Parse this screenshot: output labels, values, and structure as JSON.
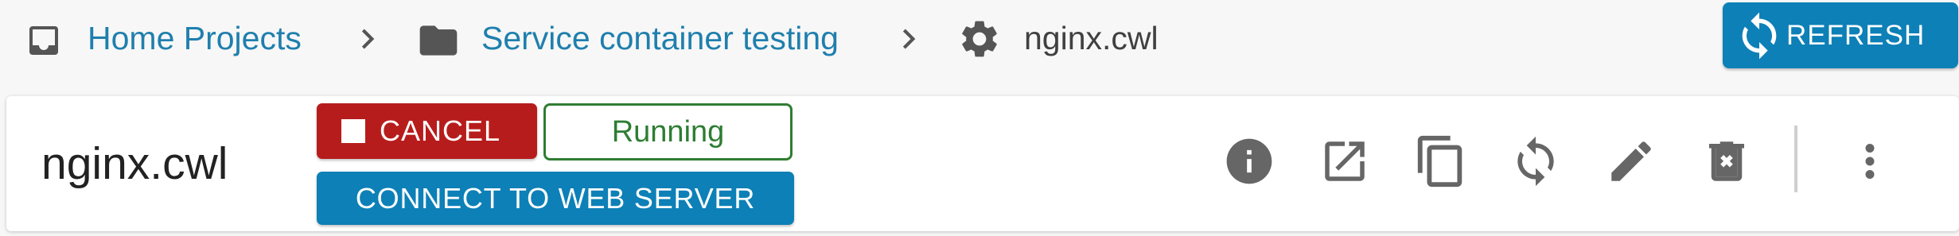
{
  "breadcrumb": {
    "items": [
      {
        "label": "Home Projects",
        "icon": "inbox-icon"
      },
      {
        "label": "Service container testing",
        "icon": "folder-icon"
      },
      {
        "label": "nginx.cwl",
        "icon": "gear-icon"
      }
    ],
    "separator_icon": "chevron-right-icon"
  },
  "toolbar": {
    "refresh_label": "REFRESH",
    "refresh_icon": "refresh-icon"
  },
  "process": {
    "title": "nginx.cwl",
    "cancel_label": "CANCEL",
    "status": "Running",
    "connect_label": "CONNECT TO WEB SERVER",
    "actions": [
      {
        "name": "info-icon"
      },
      {
        "name": "open-in-new-tab-icon"
      },
      {
        "name": "copy-icon"
      },
      {
        "name": "rerun-icon"
      },
      {
        "name": "edit-icon"
      },
      {
        "name": "remove-icon"
      },
      {
        "name": "more-options-icon"
      }
    ]
  },
  "colors": {
    "link": "#1f7fad",
    "primary": "#0d80b7",
    "danger": "#b71c1c",
    "success": "#2e7d32",
    "icon_gray": "#666666"
  }
}
